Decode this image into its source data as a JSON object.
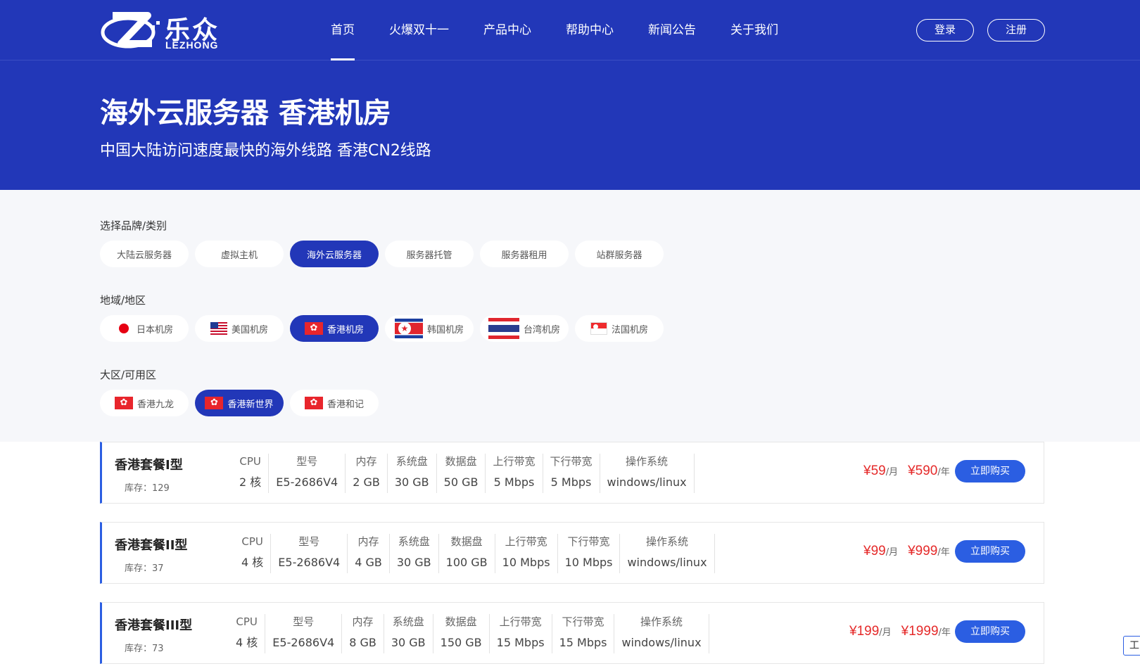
{
  "brand": {
    "cn": "乐众",
    "en": "LEZHONG"
  },
  "nav": [
    "首页",
    "火爆双十一",
    "产品中心",
    "帮助中心",
    "新闻公告",
    "关于我们"
  ],
  "auth": {
    "login": "登录",
    "register": "注册"
  },
  "banner": {
    "title": "海外云服务器 香港机房",
    "subtitle": "中国大陆访问速度最快的海外线路 香港CN2线路"
  },
  "filters": {
    "brand": {
      "label": "选择品牌/类别",
      "options": [
        "大陆云服务器",
        "虚拟主机",
        "海外云服务器",
        "服务器托管",
        "服务器租用",
        "站群服务器"
      ],
      "selected": "海外云服务器"
    },
    "region": {
      "label": "地域/地区",
      "options": [
        {
          "name": "日本机房",
          "icon": "japan-flag-icon"
        },
        {
          "name": "美国机房",
          "icon": "usa-flag-icon"
        },
        {
          "name": "香港机房",
          "icon": "hongkong-flag-icon"
        },
        {
          "name": "韩国机房",
          "icon": "korea-flag-icon"
        },
        {
          "name": "台湾机房",
          "icon": "thailand-flag-icon"
        },
        {
          "name": "法国机房",
          "icon": "singapore-flag-icon"
        }
      ],
      "selected": "香港机房"
    },
    "zone": {
      "label": "大区/可用区",
      "options": [
        "香港九龙",
        "香港新世界",
        "香港和记"
      ],
      "selected": "香港新世界"
    }
  },
  "spec_headers": [
    "CPU",
    "型号",
    "内存",
    "系统盘",
    "数据盘",
    "上行带宽",
    "下行带宽",
    "操作系统"
  ],
  "products": [
    {
      "name": "香港套餐I型",
      "stock_label": "库存：",
      "stock": "129",
      "specs": [
        "2 核",
        "E5-2686V4",
        "2 GB",
        "30 GB",
        "50 GB",
        "5 Mbps",
        "5 Mbps",
        "windows/linux"
      ],
      "price_month": "¥59",
      "month_unit": "/月",
      "price_year": "¥590",
      "year_unit": "/年",
      "buy": "立即购买"
    },
    {
      "name": "香港套餐II型",
      "stock_label": "库存：",
      "stock": "37",
      "specs": [
        "4 核",
        "E5-2686V4",
        "4 GB",
        "30 GB",
        "100 GB",
        "10 Mbps",
        "10 Mbps",
        "windows/linux"
      ],
      "price_month": "¥99",
      "month_unit": "/月",
      "price_year": "¥999",
      "year_unit": "/年",
      "buy": "立即购买"
    },
    {
      "name": "香港套餐III型",
      "stock_label": "库存：",
      "stock": "73",
      "specs": [
        "4 核",
        "E5-2686V4",
        "8 GB",
        "30 GB",
        "150 GB",
        "15 Mbps",
        "15 Mbps",
        "windows/linux"
      ],
      "price_month": "¥199",
      "month_unit": "/月",
      "price_year": "¥1999",
      "year_unit": "/年",
      "buy": "立即购买"
    }
  ],
  "side_tool": "工",
  "colors": {
    "primary": "#2237b8",
    "accent": "#2b5ee2",
    "price": "#e52a2a"
  }
}
